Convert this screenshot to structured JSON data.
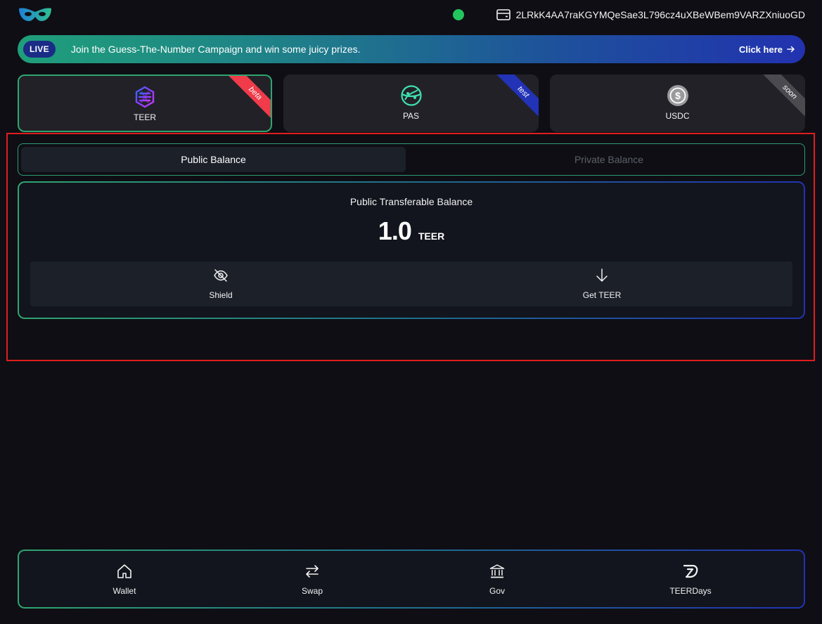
{
  "header": {
    "logo_icon": "mask-logo-icon",
    "status_color": "#22c55e",
    "wallet_icon": "wallet-icon",
    "wallet_address": "2LRkK4AA7raKGYMQeSae3L796cz4uXBeWBem9VARZXniuoGD"
  },
  "banner": {
    "badge": "LIVE",
    "text": "Join the Guess-The-Number Campaign and win some juicy prizes.",
    "cta": "Click here"
  },
  "tokens": [
    {
      "label": "TEER",
      "ribbon": "beta",
      "ribbon_color": "#ef3b4a",
      "icon": "teer-hexagon-icon",
      "selected": true
    },
    {
      "label": "PAS",
      "ribbon": "test",
      "ribbon_color": "#2233b8",
      "icon": "pas-globe-icon",
      "selected": false
    },
    {
      "label": "USDC",
      "ribbon": "soon",
      "ribbon_color": "#4a4a4f",
      "icon": "usdc-coin-icon",
      "selected": false
    }
  ],
  "tabs": {
    "public": "Public Balance",
    "private": "Private Balance"
  },
  "balance": {
    "title": "Public Transferable Balance",
    "value": "1.0",
    "unit": "TEER"
  },
  "actions": {
    "shield": "Shield",
    "get": "Get TEER"
  },
  "nav": {
    "wallet": "Wallet",
    "swap": "Swap",
    "gov": "Gov",
    "teerdays": "TEERDays"
  },
  "colors": {
    "background": "#0f0e14",
    "accent_green": "#2fa56f",
    "accent_blue": "#2232b0",
    "highlight_red": "#e11d1d"
  }
}
